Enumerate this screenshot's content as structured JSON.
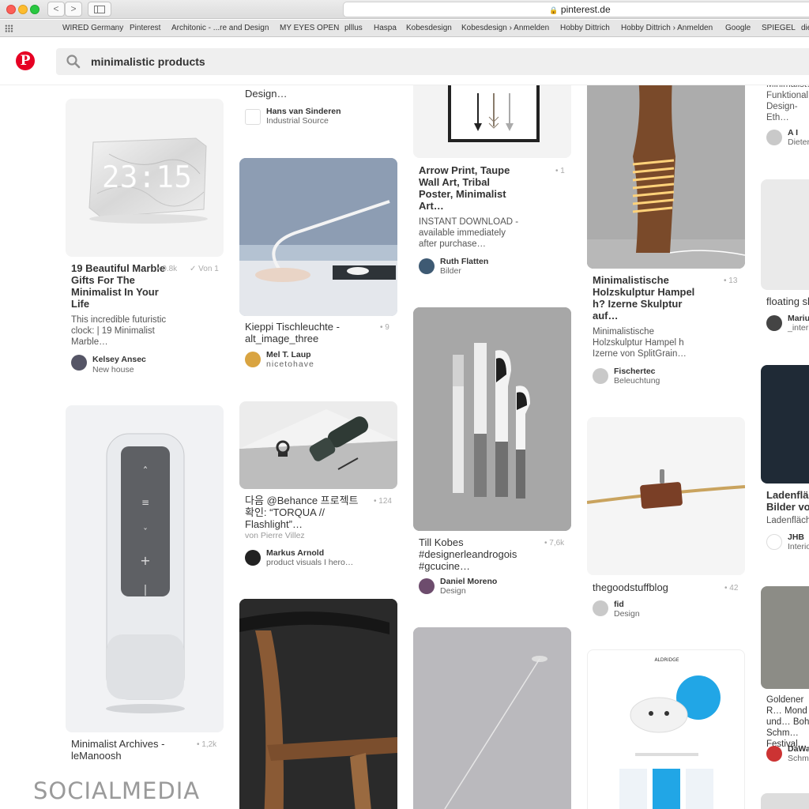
{
  "browser": {
    "url": "pinterest.de",
    "back": "<",
    "forward": ">",
    "bookmarks": [
      "WIRED Germany",
      "Pinterest",
      "Architonic - ...re and Design",
      "MY EYES OPEN",
      "plllus",
      "Haspa",
      "Kobesdesign",
      "Kobesdesign › Anmelden",
      "Hobby Dittrich",
      "Hobby Dittrich › Anmelden",
      "Google",
      "SPIEGEL",
      "die"
    ]
  },
  "search": {
    "query": "minimalistic products"
  },
  "logo": "P",
  "pins": {
    "c1a": {
      "title": "19 Beautiful Marble Gifts For The Minimalist In Your Life",
      "count": "0.8k",
      "via": "Von 1",
      "desc": "This incredible futuristic clock: | 19 Minimalist Marble…",
      "user": "Kelsey Ansec",
      "board": "New house",
      "clock": "23:15"
    },
    "c1b": {
      "title": "Minimalist Archives - leManoosh",
      "count": "1,2k"
    },
    "c2a": {
      "title_frag": "Design…",
      "user": "Hans van Sinderen",
      "board": "Industrial Source"
    },
    "c2b": {
      "title": "Kieppi Tischleuchte - alt_image_three",
      "count": "9",
      "user": "Mel T. Laup",
      "board": "nicetohave"
    },
    "c2c": {
      "title": "다음 @Behance 프로젝트 확인: “TORQUA // Flashlight”…",
      "count": "124",
      "via": "von Pierre Villez",
      "user": "Markus Arnold",
      "board": "product visuals I hero…"
    },
    "c3a": {
      "title": "Arrow Print, Taupe Wall Art, Tribal Poster, Minimalist Art…",
      "count": "1",
      "desc": "INSTANT DOWNLOAD - available immediately after purchase…",
      "user": "Ruth Flatten",
      "board": "Bilder"
    },
    "c3b": {
      "title": "Till Kobes #designerleandrogois #gcucine…",
      "count": "7,6k",
      "user": "Daniel Moreno",
      "board": "Design"
    },
    "c4a": {
      "title": "Minimalistische Holzskulptur Hampel h? Izerne Skulptur auf…",
      "count": "13",
      "desc": "Minimalistische Holzskulptur Hampel h Izerne von SplitGrain…",
      "user": "Fischertec",
      "board": "Beleuchtung"
    },
    "c4b": {
      "title": "thegoodstuffblog",
      "count": "42",
      "user": "fid",
      "board": "Design"
    },
    "c4c": {
      "site": "ALDRIDGE"
    },
    "c5a": {
      "desc": "Minimalist… Funktional… Design-Eth… Dieter Ram…",
      "user": "A I",
      "board": "Dieter"
    },
    "c5b": {
      "title": "floating sh…",
      "user": "Mariu…",
      "board": "_interi…"
    },
    "c5c": {
      "title": "Ladenflä… Bilder vo…",
      "desc": "Ladenfläch…",
      "user": "JHB",
      "board": "Interio…"
    },
    "c5d": {
      "desc": "Goldener R… Mond und… Boho Schm… Festival…",
      "user": "DaWa…",
      "board": "Schmu…"
    }
  },
  "watermark": "SOCIALMEDIA",
  "colors": {
    "pinterest_red": "#e60023"
  }
}
